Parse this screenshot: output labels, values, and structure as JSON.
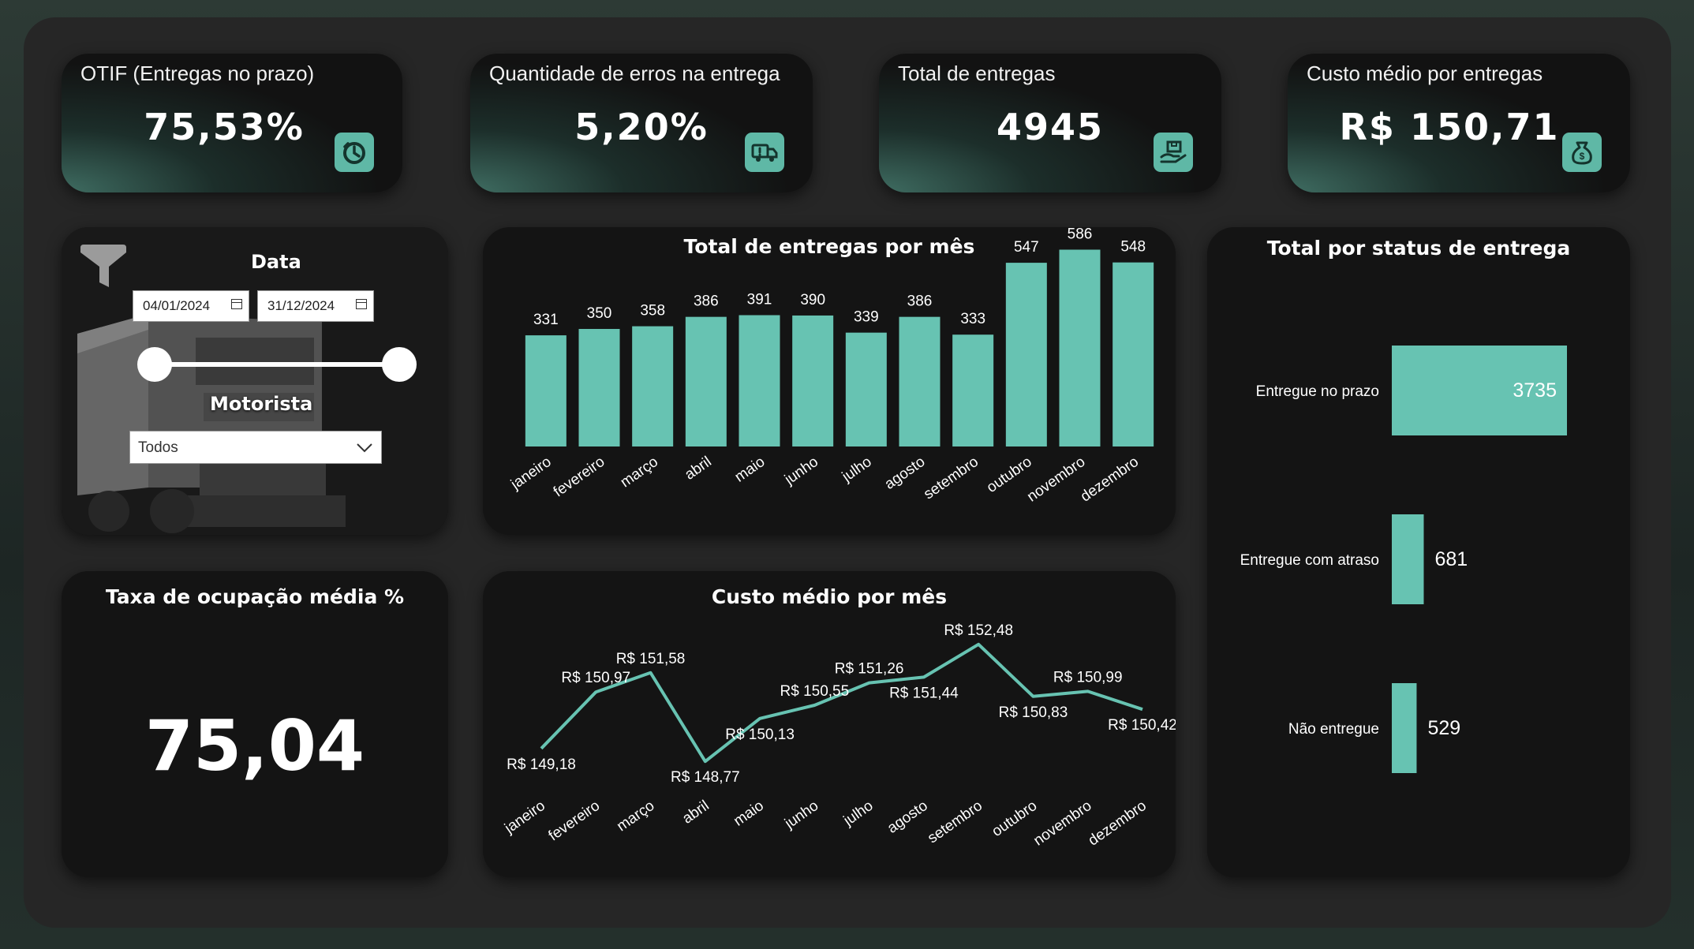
{
  "colors": {
    "accent": "#67c3b2",
    "card": "#141414",
    "canvas": "#262626"
  },
  "kpis": [
    {
      "label": "OTIF (Entregas no prazo)",
      "value": "75,53%",
      "icon": "clock-icon"
    },
    {
      "label": "Quantidade de erros na entrega",
      "value": "5,20%",
      "icon": "truck-icon"
    },
    {
      "label": "Total de entregas",
      "value": "4945",
      "icon": "hand-box-icon"
    },
    {
      "label": "Custo médio por entregas",
      "value": "R$ 150,71",
      "icon": "money-bag-icon"
    }
  ],
  "filters": {
    "date_title": "Data",
    "date_start": "04/01/2024",
    "date_end": "31/12/2024",
    "slider_start": 0,
    "slider_end": 1,
    "driver_title": "Motorista",
    "driver_value": "Todos"
  },
  "occupancy": {
    "title": "Taxa de ocupação média %",
    "value": "75,04"
  },
  "monthly_deliveries": {
    "title": "Total de entregas por mês",
    "chart_data": {
      "type": "bar",
      "categories": [
        "janeiro",
        "fevereiro",
        "março",
        "abril",
        "maio",
        "junho",
        "julho",
        "agosto",
        "setembro",
        "outubro",
        "novembro",
        "dezembro"
      ],
      "values": [
        331,
        350,
        358,
        386,
        391,
        390,
        339,
        386,
        333,
        547,
        586,
        548
      ],
      "labels": [
        "331",
        "350",
        "358",
        "386",
        "391",
        "390",
        "339",
        "386",
        "333",
        "547",
        "586",
        "548"
      ],
      "ylim": [
        0,
        640
      ]
    }
  },
  "monthly_cost": {
    "title": "Custo médio por mês",
    "chart_data": {
      "type": "line",
      "categories": [
        "janeiro",
        "fevereiro",
        "março",
        "abril",
        "maio",
        "junho",
        "julho",
        "agosto",
        "setembro",
        "outubro",
        "novembro",
        "dezembro"
      ],
      "values": [
        149.18,
        150.97,
        151.58,
        148.77,
        150.13,
        150.55,
        151.26,
        151.44,
        152.48,
        150.83,
        150.99,
        150.42
      ],
      "labels": [
        "R$ 149,18",
        "R$ 150,97",
        "R$ 151,58",
        "R$ 148,77",
        "R$ 150,13",
        "R$ 150,55",
        "R$ 151,26",
        "R$ 151,44",
        "R$ 152,48",
        "R$ 150,83",
        "R$ 150,99",
        "R$ 150,42"
      ],
      "label_position": [
        "below",
        "above",
        "above",
        "below",
        "below",
        "above",
        "above",
        "below",
        "above",
        "below",
        "above",
        "below"
      ],
      "ylim": [
        148.5,
        152.8
      ]
    }
  },
  "status": {
    "title": "Total por status de entrega",
    "chart_data": {
      "type": "bar",
      "orientation": "horizontal",
      "categories": [
        "Entregue no prazo",
        "Entregue com atraso",
        "Não entregue"
      ],
      "values": [
        3735,
        681,
        529
      ],
      "labels": [
        "3735",
        "681",
        "529"
      ],
      "xlim": [
        0,
        3735
      ]
    }
  }
}
